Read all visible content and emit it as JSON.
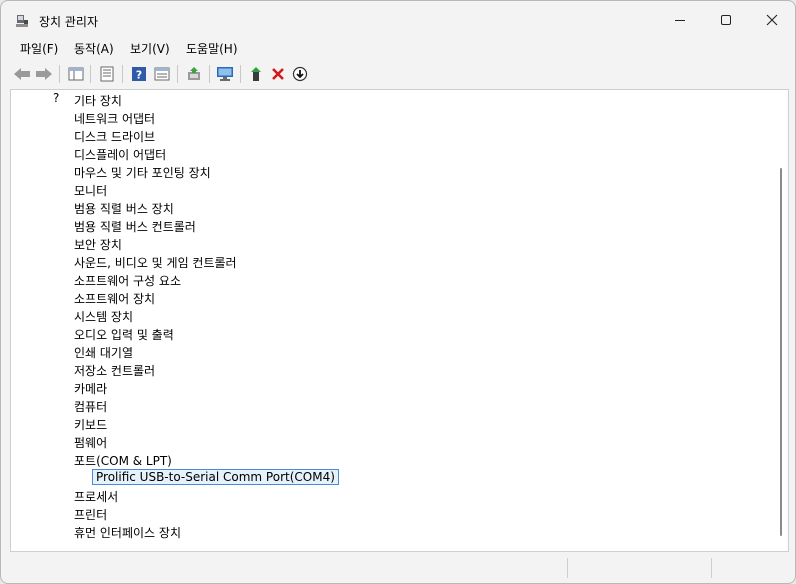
{
  "window": {
    "title": "장치 관리자"
  },
  "menu": [
    "파일(F)",
    "동작(A)",
    "보기(V)",
    "도움말(H)"
  ],
  "tree": {
    "categories": [
      {
        "label": "기타 장치",
        "icon": "unknown-device-icon",
        "expanded": false
      },
      {
        "label": "네트워크 어댑터",
        "icon": "network-adapter-icon",
        "expanded": false
      },
      {
        "label": "디스크 드라이브",
        "icon": "disk-drive-icon",
        "expanded": false
      },
      {
        "label": "디스플레이 어댑터",
        "icon": "display-adapter-icon",
        "expanded": false
      },
      {
        "label": "마우스 및 기타 포인팅 장치",
        "icon": "mouse-icon",
        "expanded": false
      },
      {
        "label": "모니터",
        "icon": "monitor-icon",
        "expanded": false
      },
      {
        "label": "범용 직렬 버스 장치",
        "icon": "usb-icon",
        "expanded": false
      },
      {
        "label": "범용 직렬 버스 컨트롤러",
        "icon": "usb-icon",
        "expanded": false
      },
      {
        "label": "보안 장치",
        "icon": "security-device-icon",
        "expanded": false
      },
      {
        "label": "사운드, 비디오 및 게임 컨트롤러",
        "icon": "speaker-icon",
        "expanded": false
      },
      {
        "label": "소프트웨어 구성 요소",
        "icon": "software-component-icon",
        "expanded": false
      },
      {
        "label": "소프트웨어 장치",
        "icon": "software-device-icon",
        "expanded": false
      },
      {
        "label": "시스템 장치",
        "icon": "system-device-icon",
        "expanded": false
      },
      {
        "label": "오디오 입력 및 출력",
        "icon": "speaker-icon",
        "expanded": false
      },
      {
        "label": "인쇄 대기열",
        "icon": "printer-icon",
        "expanded": false
      },
      {
        "label": "저장소 컨트롤러",
        "icon": "storage-controller-icon",
        "expanded": false
      },
      {
        "label": "카메라",
        "icon": "camera-icon",
        "expanded": false
      },
      {
        "label": "컴퓨터",
        "icon": "computer-icon",
        "expanded": false
      },
      {
        "label": "키보드",
        "icon": "keyboard-icon",
        "expanded": false
      },
      {
        "label": "펌웨어",
        "icon": "firmware-icon",
        "expanded": false
      },
      {
        "label": "포트(COM & LPT)",
        "icon": "port-icon",
        "expanded": true,
        "children": [
          {
            "label": "Prolific USB-to-Serial Comm Port(COM4)",
            "icon": "port-icon",
            "selected": true
          }
        ]
      },
      {
        "label": "프로세서",
        "icon": "processor-icon",
        "expanded": false
      },
      {
        "label": "프린터",
        "icon": "printer-icon",
        "expanded": false
      },
      {
        "label": "휴먼 인터페이스 장치",
        "icon": "hid-icon",
        "expanded": false
      }
    ]
  }
}
